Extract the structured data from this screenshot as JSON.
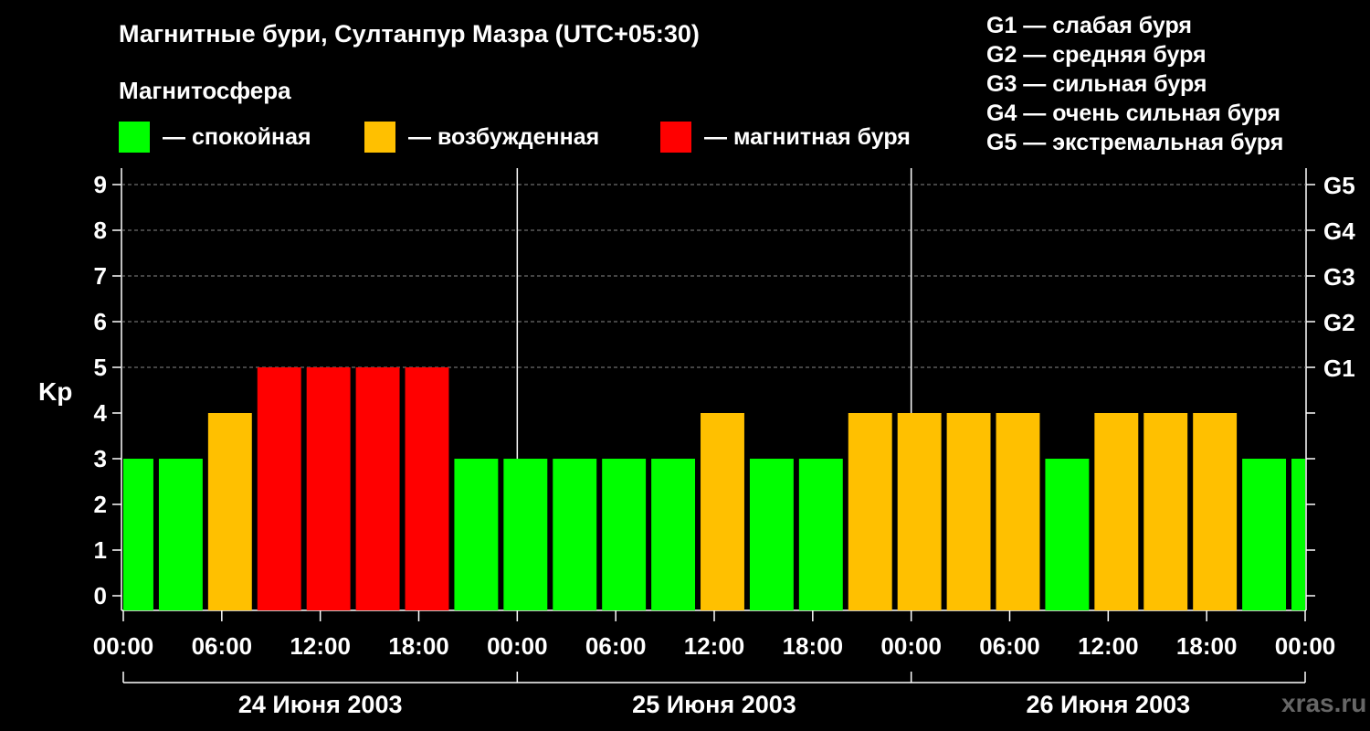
{
  "header": {
    "title": "Магнитные бури, Султанпур Мазра (UTC+05:30)",
    "magnetosphere_label": "Магнитосфера"
  },
  "legend": [
    {
      "label": "— спокойная",
      "color": "#00ff00"
    },
    {
      "label": "— возбужденная",
      "color": "#ffc000"
    },
    {
      "label": "— магнитная буря",
      "color": "#ff0000"
    }
  ],
  "g_scale": [
    "G1 — слабая буря",
    "G2 — средняя буря",
    "G3 — сильная буря",
    "G4 — очень сильная буря",
    "G5 — экстремальная буря"
  ],
  "watermark": "xras.ru",
  "chart_data": {
    "type": "bar",
    "ylabel": "Kp",
    "ylim": [
      0,
      9
    ],
    "y_ticks": [
      0,
      1,
      2,
      3,
      4,
      5,
      6,
      7,
      8,
      9
    ],
    "right_ticks": [
      {
        "kp": 5,
        "label": "G1"
      },
      {
        "kp": 6,
        "label": "G2"
      },
      {
        "kp": 7,
        "label": "G3"
      },
      {
        "kp": 8,
        "label": "G4"
      },
      {
        "kp": 9,
        "label": "G5"
      }
    ],
    "x_tick_labels": [
      "00:00",
      "06:00",
      "12:00",
      "18:00",
      "00:00",
      "06:00",
      "12:00",
      "18:00",
      "00:00",
      "06:00",
      "12:00",
      "18:00",
      "00:00"
    ],
    "days": [
      "24 Июня 2003",
      "25 Июня 2003",
      "26 Июня 2003"
    ],
    "grid": "dashed horizontal at Kp 5–9",
    "colors": {
      "quiet": "#00ff00",
      "unsettled": "#ffc000",
      "storm": "#ff0000"
    },
    "bars": [
      {
        "start_hour": 0.0,
        "end_hour": 2.0,
        "kp": 3
      },
      {
        "start_hour": 2.0,
        "end_hour": 5.0,
        "kp": 3
      },
      {
        "start_hour": 5.0,
        "end_hour": 8.0,
        "kp": 4
      },
      {
        "start_hour": 8.0,
        "end_hour": 11.0,
        "kp": 5
      },
      {
        "start_hour": 11.0,
        "end_hour": 14.0,
        "kp": 5
      },
      {
        "start_hour": 14.0,
        "end_hour": 17.0,
        "kp": 5
      },
      {
        "start_hour": 17.0,
        "end_hour": 20.0,
        "kp": 5
      },
      {
        "start_hour": 20.0,
        "end_hour": 23.0,
        "kp": 3
      },
      {
        "start_hour": 23.0,
        "end_hour": 26.0,
        "kp": 3
      },
      {
        "start_hour": 26.0,
        "end_hour": 29.0,
        "kp": 3
      },
      {
        "start_hour": 29.0,
        "end_hour": 32.0,
        "kp": 3
      },
      {
        "start_hour": 32.0,
        "end_hour": 35.0,
        "kp": 3
      },
      {
        "start_hour": 35.0,
        "end_hour": 38.0,
        "kp": 4
      },
      {
        "start_hour": 38.0,
        "end_hour": 41.0,
        "kp": 3
      },
      {
        "start_hour": 41.0,
        "end_hour": 44.0,
        "kp": 3
      },
      {
        "start_hour": 44.0,
        "end_hour": 47.0,
        "kp": 4
      },
      {
        "start_hour": 47.0,
        "end_hour": 50.0,
        "kp": 4
      },
      {
        "start_hour": 50.0,
        "end_hour": 53.0,
        "kp": 4
      },
      {
        "start_hour": 53.0,
        "end_hour": 56.0,
        "kp": 4
      },
      {
        "start_hour": 56.0,
        "end_hour": 59.0,
        "kp": 3
      },
      {
        "start_hour": 59.0,
        "end_hour": 62.0,
        "kp": 4
      },
      {
        "start_hour": 62.0,
        "end_hour": 65.0,
        "kp": 4
      },
      {
        "start_hour": 65.0,
        "end_hour": 68.0,
        "kp": 4
      },
      {
        "start_hour": 68.0,
        "end_hour": 71.0,
        "kp": 3
      },
      {
        "start_hour": 71.0,
        "end_hour": 72.0,
        "kp": 3
      }
    ]
  }
}
